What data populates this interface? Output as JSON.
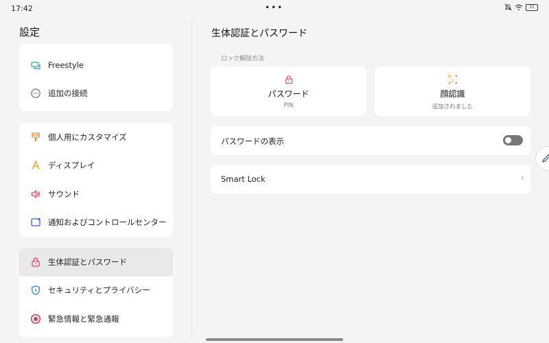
{
  "status_bar": {
    "time": "17:42",
    "dots": "•••",
    "battery": "31"
  },
  "left": {
    "title": "設定",
    "group1": [
      {
        "label": "Freestyle",
        "icon": "freestyle-icon"
      },
      {
        "label": "追加の接続",
        "icon": "more-connections-icon"
      }
    ],
    "group2": [
      {
        "label": "個人用にカスタマイズ",
        "icon": "brush-icon"
      },
      {
        "label": "ディスプレイ",
        "icon": "display-icon"
      },
      {
        "label": "サウンド",
        "icon": "sound-icon"
      },
      {
        "label": "通知およびコントロールセンター",
        "icon": "notification-icon"
      }
    ],
    "group3": [
      {
        "label": "生体認証とパスワード",
        "icon": "lock-icon",
        "selected": true
      },
      {
        "label": "セキュリティとプライバシー",
        "icon": "shield-icon"
      },
      {
        "label": "緊急情報と緊急通報",
        "icon": "emergency-icon"
      }
    ]
  },
  "right": {
    "title": "生体認証とパスワード",
    "unlock_section_label": "ロック解除方法",
    "password_card": {
      "name": "パスワード",
      "sub": "PIN"
    },
    "face_card": {
      "name": "顔認識",
      "sub": "追加されました"
    },
    "show_password": {
      "label": "パスワードの表示",
      "enabled": false
    },
    "smart_lock": {
      "label": "Smart Lock",
      "chevron": "›"
    }
  },
  "colors": {
    "accent_red": "#e8475a",
    "accent_orange": "#f08a3c",
    "accent_blue": "#2e7be6",
    "accent_teal": "#2aa7a7"
  }
}
